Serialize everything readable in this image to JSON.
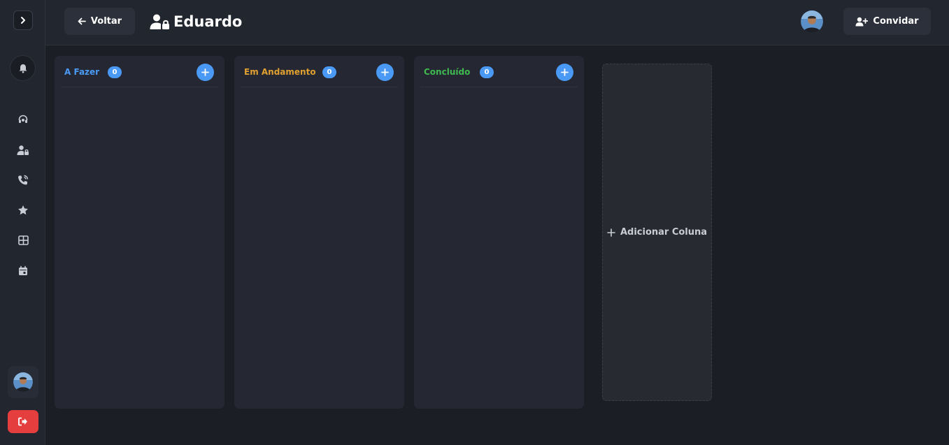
{
  "sidebar": {
    "toggle_icon": "chevron-right-icon",
    "notifications_icon": "bell-icon",
    "nav_items": [
      {
        "name": "headset-icon"
      },
      {
        "name": "user-lock-icon"
      },
      {
        "name": "phone-icon"
      },
      {
        "name": "star-icon"
      },
      {
        "name": "grid-icon"
      },
      {
        "name": "calendar-icon"
      }
    ],
    "logout_icon": "sign-out-icon"
  },
  "header": {
    "back_label": "Voltar",
    "title": "Eduardo",
    "invite_label": "Convidar"
  },
  "board": {
    "columns": [
      {
        "title": "A Fazer",
        "count": "0",
        "color": "#4a9af5"
      },
      {
        "title": "Em Andamento",
        "count": "0",
        "color": "#e0a030"
      },
      {
        "title": "Concluído",
        "count": "0",
        "color": "#3fb950"
      }
    ],
    "add_column_label": "Adicionar Coluna"
  },
  "colors": {
    "accent": "#4a9af5",
    "danger": "#e53e3e",
    "background": "#1b1e25"
  }
}
